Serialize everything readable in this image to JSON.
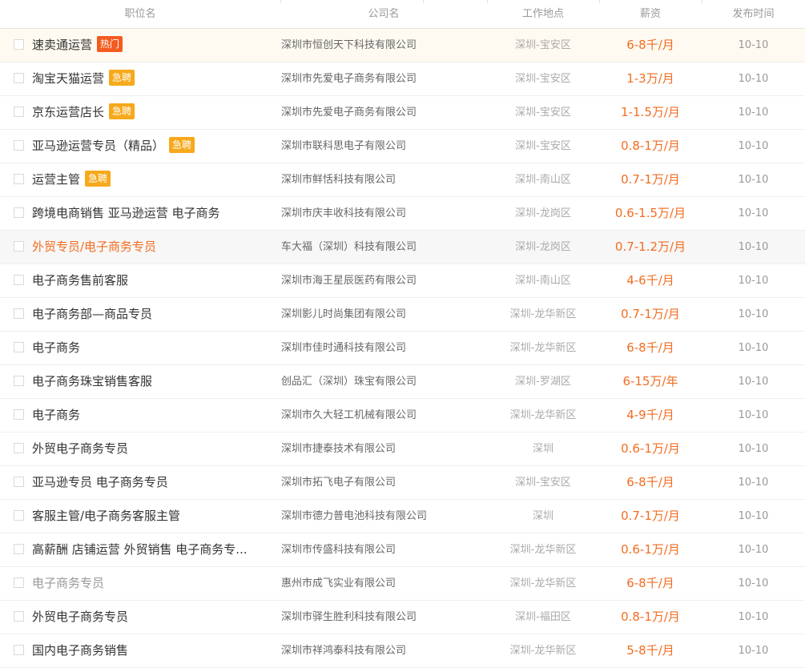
{
  "headers": {
    "job": "职位名",
    "company": "公司名",
    "location": "工作地点",
    "salary": "薪资",
    "date": "发布时间"
  },
  "colors": {
    "salary": "#f26d21",
    "badge_hot": "#f35b1f",
    "badge_urgent": "#f6a91b",
    "visited_job": "#f26d21"
  },
  "rows": [
    {
      "job": "速卖通运营",
      "badge": "热门",
      "badge_type": "hot",
      "company": "深圳市恒创天下科技有限公司",
      "location": "深圳-宝安区",
      "salary": "6-8千/月",
      "date": "10-10"
    },
    {
      "job": "淘宝天猫运营",
      "badge": "急聘",
      "badge_type": "urgent",
      "company": "深圳市先爱电子商务有限公司",
      "location": "深圳-宝安区",
      "salary": "1-3万/月",
      "date": "10-10"
    },
    {
      "job": "京东运营店长",
      "badge": "急聘",
      "badge_type": "urgent",
      "company": "深圳市先爱电子商务有限公司",
      "location": "深圳-宝安区",
      "salary": "1-1.5万/月",
      "date": "10-10"
    },
    {
      "job": "亚马逊运营专员（精品）",
      "badge": "急聘",
      "badge_type": "urgent",
      "company": "深圳市联科思电子有限公司",
      "location": "深圳-宝安区",
      "salary": "0.8-1万/月",
      "date": "10-10"
    },
    {
      "job": "运营主管",
      "badge": "急聘",
      "badge_type": "urgent",
      "company": "深圳市鲜恬科技有限公司",
      "location": "深圳-南山区",
      "salary": "0.7-1万/月",
      "date": "10-10"
    },
    {
      "job": "跨境电商销售 亚马逊运营 电子商务",
      "badge": "",
      "badge_type": "",
      "company": "深圳市庆丰收科技有限公司",
      "location": "深圳-龙岗区",
      "salary": "0.6-1.5万/月",
      "date": "10-10"
    },
    {
      "job": "外贸专员/电子商务专员",
      "badge": "",
      "badge_type": "",
      "company": "车大福（深圳）科技有限公司",
      "location": "深圳-龙岗区",
      "salary": "0.7-1.2万/月",
      "date": "10-10"
    },
    {
      "job": "电子商务售前客服",
      "badge": "",
      "badge_type": "",
      "company": "深圳市海王星辰医药有限公司",
      "location": "深圳-南山区",
      "salary": "4-6千/月",
      "date": "10-10"
    },
    {
      "job": "电子商务部—商品专员",
      "badge": "",
      "badge_type": "",
      "company": "深圳影儿时尚集团有限公司",
      "location": "深圳-龙华新区",
      "salary": "0.7-1万/月",
      "date": "10-10"
    },
    {
      "job": "电子商务",
      "badge": "",
      "badge_type": "",
      "company": "深圳市佳时通科技有限公司",
      "location": "深圳-龙华新区",
      "salary": "6-8千/月",
      "date": "10-10"
    },
    {
      "job": "电子商务珠宝销售客服",
      "badge": "",
      "badge_type": "",
      "company": "创品汇（深圳）珠宝有限公司",
      "location": "深圳-罗湖区",
      "salary": "6-15万/年",
      "date": "10-10"
    },
    {
      "job": "电子商务",
      "badge": "",
      "badge_type": "",
      "company": "深圳市久大轻工机械有限公司",
      "location": "深圳-龙华新区",
      "salary": "4-9千/月",
      "date": "10-10"
    },
    {
      "job": "外贸电子商务专员",
      "badge": "",
      "badge_type": "",
      "company": "深圳市捷泰技术有限公司",
      "location": "深圳",
      "salary": "0.6-1万/月",
      "date": "10-10"
    },
    {
      "job": "亚马逊专员 电子商务专员",
      "badge": "",
      "badge_type": "",
      "company": "深圳市拓飞电子有限公司",
      "location": "深圳-宝安区",
      "salary": "6-8千/月",
      "date": "10-10"
    },
    {
      "job": "客服主管/电子商务客服主管",
      "badge": "",
      "badge_type": "",
      "company": "深圳市德力普电池科技有限公司",
      "location": "深圳",
      "salary": "0.7-1万/月",
      "date": "10-10"
    },
    {
      "job": "高薪酬 店铺运营 外贸销售 电子商务专...",
      "badge": "",
      "badge_type": "",
      "company": "深圳市传盛科技有限公司",
      "location": "深圳-龙华新区",
      "salary": "0.6-1万/月",
      "date": "10-10"
    },
    {
      "job": "电子商务专员",
      "badge": "",
      "badge_type": "",
      "company": "惠州市成飞实业有限公司",
      "location": "深圳-龙华新区",
      "salary": "6-8千/月",
      "date": "10-10"
    },
    {
      "job": "外贸电子商务专员",
      "badge": "",
      "badge_type": "",
      "company": "深圳市驿生胜利科技有限公司",
      "location": "深圳-福田区",
      "salary": "0.8-1万/月",
      "date": "10-10"
    },
    {
      "job": "国内电子商务销售",
      "badge": "",
      "badge_type": "",
      "company": "深圳市祥鸿泰科技有限公司",
      "location": "深圳-龙华新区",
      "salary": "5-8千/月",
      "date": "10-10"
    }
  ]
}
